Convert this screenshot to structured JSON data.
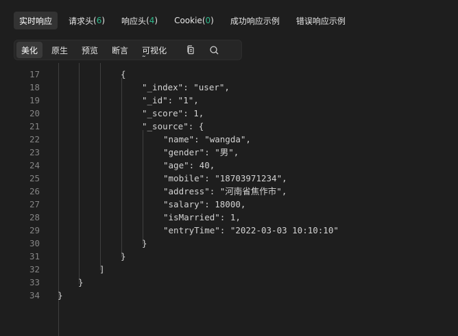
{
  "tabs": [
    {
      "label": "实时响应",
      "count": "",
      "active": true
    },
    {
      "label": "请求头",
      "count": "6",
      "active": false
    },
    {
      "label": "响应头",
      "count": "4",
      "active": false
    },
    {
      "label": "Cookie",
      "count": "0",
      "active": false
    },
    {
      "label": "成功响应示例",
      "count": "",
      "active": false
    },
    {
      "label": "错误响应示例",
      "count": "",
      "active": false
    }
  ],
  "toolbar": {
    "buttons": [
      "美化",
      "原生",
      "预览",
      "断言",
      "可视化"
    ],
    "active": "美化",
    "icons": [
      "copy-icon",
      "search-icon"
    ]
  },
  "editor": {
    "lines": [
      {
        "n": "17",
        "text": "{"
      },
      {
        "n": "18",
        "text": "\"_index\": \"user\","
      },
      {
        "n": "19",
        "text": "\"_id\": \"1\","
      },
      {
        "n": "20",
        "text": "\"_score\": 1,"
      },
      {
        "n": "21",
        "text": "\"_source\": {"
      },
      {
        "n": "22",
        "text": "\"name\": \"wangda\","
      },
      {
        "n": "23",
        "text": "\"gender\": \"男\","
      },
      {
        "n": "24",
        "text": "\"age\": 40,"
      },
      {
        "n": "25",
        "text": "\"mobile\": \"18703971234\","
      },
      {
        "n": "26",
        "text": "\"address\": \"河南省焦作市\","
      },
      {
        "n": "27",
        "text": "\"salary\": 18000,"
      },
      {
        "n": "28",
        "text": "\"isMarried\": 1,"
      },
      {
        "n": "29",
        "text": "\"entryTime\": \"2022-03-03 10:10:10\""
      },
      {
        "n": "30",
        "text": "}"
      },
      {
        "n": "31",
        "text": "}"
      },
      {
        "n": "32",
        "text": "]"
      },
      {
        "n": "33",
        "text": "}"
      },
      {
        "n": "34",
        "text": "}"
      }
    ]
  }
}
